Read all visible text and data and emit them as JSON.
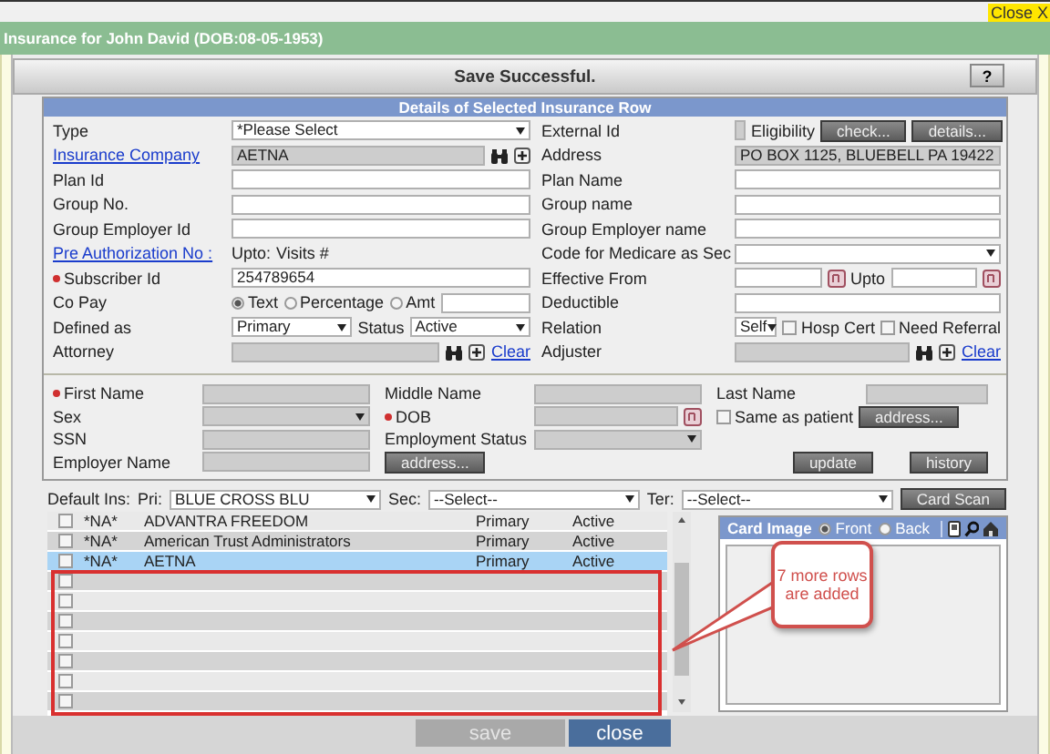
{
  "close_link": "Close X",
  "title": "Insurance for John David (DOB:08-05-1953)",
  "message": "Save Successful.",
  "help_button": "?",
  "details": {
    "title": "Details of Selected Insurance Row",
    "rows": [
      [
        {
          "label": "Type",
          "kind": "plain",
          "controls": [
            {
              "kind": "select",
              "value": "*Please Select"
            }
          ]
        },
        {
          "label": "External Id",
          "kind": "plain",
          "controls": [
            {
              "kind": "readonly"
            },
            {
              "kind": "note",
              "text": "Eligibility"
            },
            {
              "kind": "button",
              "label": "check..."
            },
            {
              "kind": "button",
              "label": "details..."
            }
          ]
        }
      ],
      [
        {
          "label": "Insurance Company",
          "kind": "link",
          "controls": [
            {
              "kind": "readonly",
              "value": "AETNA"
            },
            {
              "kind": "binoculars"
            },
            {
              "kind": "plus"
            }
          ]
        },
        {
          "label": "Address",
          "kind": "plain",
          "controls": [
            {
              "kind": "readonly",
              "value": "PO BOX 1125, BLUEBELL PA 19422"
            }
          ]
        }
      ],
      [
        {
          "label": "Plan Id",
          "kind": "plain",
          "controls": [
            {
              "kind": "text"
            }
          ]
        },
        {
          "label": "Plan Name",
          "kind": "plain",
          "controls": [
            {
              "kind": "text"
            }
          ]
        }
      ],
      [
        {
          "label": "Group No.",
          "kind": "plain",
          "controls": [
            {
              "kind": "text"
            }
          ]
        },
        {
          "label": "Group name",
          "kind": "plain",
          "controls": [
            {
              "kind": "text"
            }
          ]
        }
      ],
      [
        {
          "label": "Group Employer Id",
          "kind": "plain",
          "controls": [
            {
              "kind": "text"
            }
          ]
        },
        {
          "label": "Group Employer name",
          "kind": "plain",
          "controls": [
            {
              "kind": "text"
            }
          ]
        }
      ],
      [
        {
          "label": "Pre Authorization No :",
          "kind": "link",
          "controls": [
            {
              "kind": "note",
              "text": "Upto:"
            },
            {
              "kind": "note",
              "text": "Visits #"
            }
          ]
        },
        {
          "label": "Code for Medicare as Sec",
          "kind": "plain",
          "controls": [
            {
              "kind": "select"
            }
          ]
        }
      ],
      [
        {
          "label": "Subscriber Id",
          "kind": "required",
          "controls": [
            {
              "kind": "text",
              "value": "254789654"
            }
          ]
        },
        {
          "label": "Effective From",
          "kind": "plain",
          "controls": [
            {
              "kind": "text"
            },
            {
              "kind": "date"
            },
            {
              "kind": "note",
              "text": "Upto"
            },
            {
              "kind": "text"
            },
            {
              "kind": "date"
            }
          ]
        }
      ],
      [
        {
          "label": "Co Pay",
          "kind": "plain",
          "controls": [
            {
              "kind": "radio",
              "label": "Text",
              "selected": true
            },
            {
              "kind": "radio",
              "label": "Percentage",
              "selected": false
            },
            {
              "kind": "radio",
              "label": "Amt",
              "selected": false
            },
            {
              "kind": "text"
            }
          ]
        },
        {
          "label": "Deductible",
          "kind": "plain",
          "controls": [
            {
              "kind": "text"
            }
          ]
        }
      ],
      [
        {
          "label": "Defined as",
          "kind": "plain",
          "controls": [
            {
              "kind": "select",
              "value": "Primary"
            },
            {
              "kind": "note",
              "text": "Status"
            },
            {
              "kind": "select",
              "value": "Active"
            }
          ]
        },
        {
          "label": "Relation",
          "kind": "plain",
          "controls": [
            {
              "kind": "select",
              "value": "Self"
            },
            {
              "kind": "checkbox",
              "label": "Hosp Cert",
              "checked": false
            },
            {
              "kind": "checkbox",
              "label": "Need Referral",
              "checked": false
            }
          ]
        }
      ],
      [
        {
          "label": "Attorney",
          "kind": "plain",
          "controls": [
            {
              "kind": "readonly"
            },
            {
              "kind": "binoculars"
            },
            {
              "kind": "plus"
            },
            {
              "kind": "link",
              "label": "Clear"
            }
          ]
        },
        {
          "label": "Adjuster",
          "kind": "plain",
          "controls": [
            {
              "kind": "readonly"
            },
            {
              "kind": "binoculars"
            },
            {
              "kind": "plus"
            },
            {
              "kind": "link",
              "label": "Clear"
            }
          ]
        }
      ]
    ],
    "person_rows": [
      [
        {
          "label": "First Name",
          "kind": "required",
          "controls": [
            {
              "kind": "readonly"
            }
          ]
        },
        {
          "label": "Middle Name",
          "kind": "plain",
          "controls": [
            {
              "kind": "readonly"
            }
          ]
        },
        {
          "label": "Last Name",
          "kind": "plain",
          "controls": [
            {
              "kind": "readonly"
            }
          ]
        }
      ],
      [
        {
          "label": "Sex",
          "kind": "plain",
          "controls": [
            {
              "kind": "locked-select"
            }
          ]
        },
        {
          "label": "DOB",
          "kind": "required",
          "controls": [
            {
              "kind": "readonly"
            },
            {
              "kind": "date"
            }
          ]
        },
        {
          "controls": [
            {
              "kind": "checkbox",
              "label": "Same as patient",
              "checked": false
            },
            {
              "kind": "button",
              "label": "address..."
            }
          ]
        }
      ],
      [
        {
          "label": "SSN",
          "kind": "plain",
          "controls": [
            {
              "kind": "readonly"
            }
          ]
        },
        {
          "label": "Employment Status",
          "kind": "plain",
          "controls": [
            {
              "kind": "locked-select"
            }
          ]
        }
      ],
      [
        {
          "label": "Employer Name",
          "kind": "plain",
          "controls": [
            {
              "kind": "readonly"
            }
          ]
        },
        {
          "controls": [
            {
              "kind": "button",
              "label": "address..."
            }
          ]
        },
        {
          "controls": [
            {
              "kind": "button",
              "label": "update"
            },
            {
              "kind": "button",
              "label": "history"
            }
          ]
        }
      ]
    ]
  },
  "default_ins": {
    "label": "Default Ins:",
    "selects": [
      {
        "label": "Pri:",
        "value": "BLUE CROSS BLU"
      },
      {
        "label": "Sec:",
        "value": "--Select--"
      },
      {
        "label": "Ter:",
        "value": "--Select--"
      }
    ]
  },
  "card_scan_button": "Card Scan",
  "policies": {
    "rows": [
      {
        "checked": false,
        "selected": false,
        "column_1": "*NA*",
        "column_2": "ADVANTRA FREEDOM",
        "column_4": "Primary",
        "column_5": "Active"
      },
      {
        "checked": false,
        "selected": false,
        "column_1": "*NA*",
        "column_2": "American Trust Administrators",
        "column_4": "Primary",
        "column_5": "Active"
      },
      {
        "checked": false,
        "selected": true,
        "column_1": "*NA*",
        "column_2": "AETNA",
        "column_4": "Primary",
        "column_5": "Active"
      },
      {
        "checked": false,
        "selected": false
      },
      {
        "checked": false,
        "selected": false
      },
      {
        "checked": false,
        "selected": false
      },
      {
        "checked": false,
        "selected": false
      },
      {
        "checked": false,
        "selected": false
      },
      {
        "checked": false,
        "selected": false
      },
      {
        "checked": false,
        "selected": false
      }
    ]
  },
  "card_image": {
    "title": "Card Image",
    "sides": [
      {
        "label": "Front",
        "selected": true
      },
      {
        "label": "Back",
        "selected": false
      }
    ]
  },
  "annotation": {
    "text": "7 more rows are added"
  },
  "footer_buttons": [
    {
      "label": "save",
      "disabled": true
    },
    {
      "label": "close",
      "disabled": false
    }
  ]
}
